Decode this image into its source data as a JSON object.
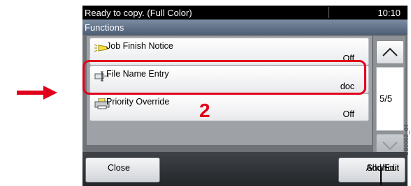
{
  "status_bar": {
    "message": "Ready to copy. (Full Color)",
    "time": "10:10"
  },
  "header": {
    "title": "Functions"
  },
  "items": [
    {
      "label": "Job Finish Notice",
      "value": "Off",
      "icon": "lightbulb-icon"
    },
    {
      "label": "File Name Entry",
      "value": "doc",
      "icon": "file-name-icon"
    },
    {
      "label": "Priority Override",
      "value": "Off",
      "icon": "printer-icon"
    }
  ],
  "pager": {
    "page": "5/5"
  },
  "buttons": {
    "close": "Close",
    "add_edit_line1": "Add/Edit",
    "add_edit_line2": "Shortcut"
  },
  "annotation": {
    "step": "2",
    "figure_code": "GB0002_04"
  },
  "colors": {
    "highlight": "#e0001b",
    "header_blue": "#5d6e86"
  }
}
